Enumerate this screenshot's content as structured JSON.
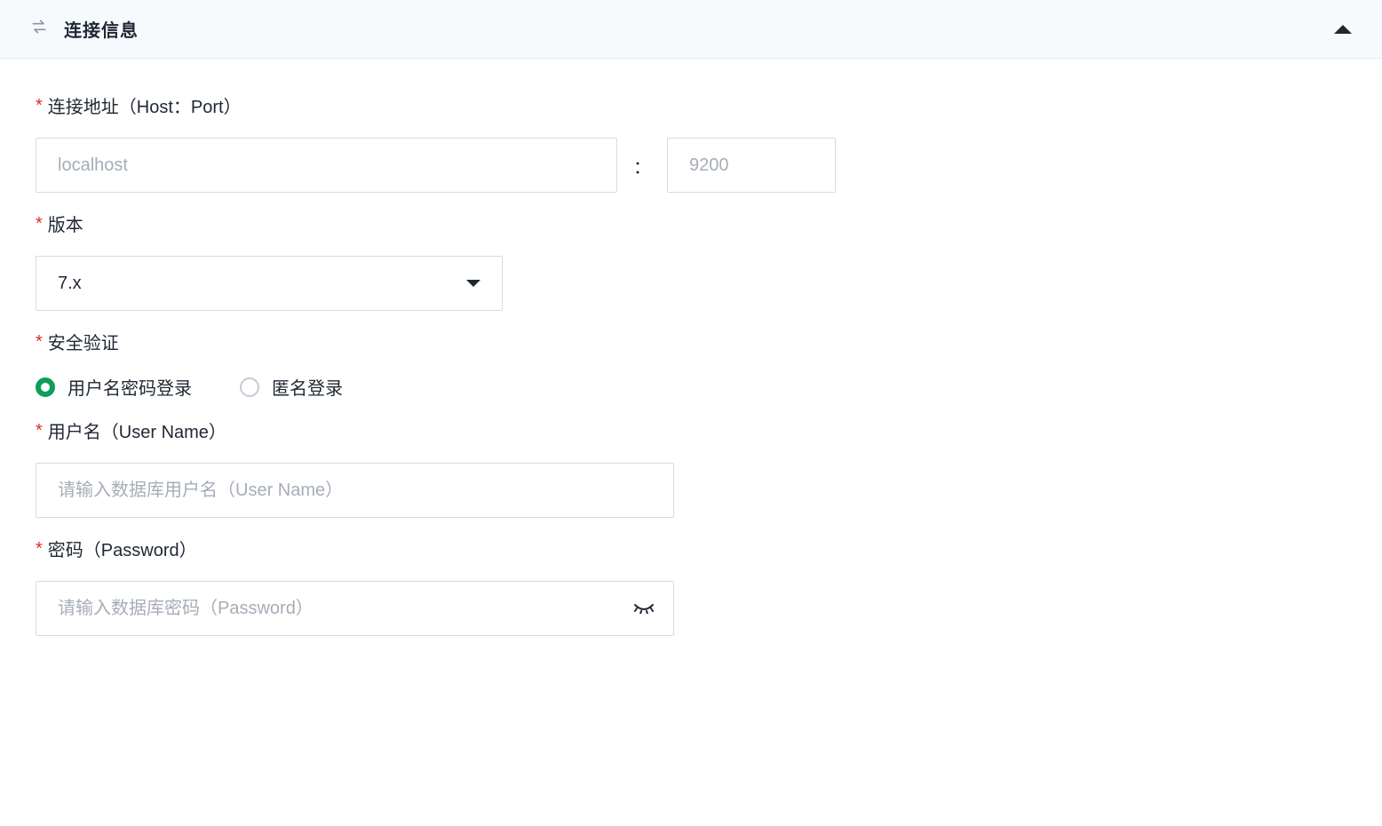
{
  "panel": {
    "title": "连接信息"
  },
  "fields": {
    "host": {
      "label": "连接地址（Host：Port）",
      "host_placeholder": "localhost",
      "separator": "：",
      "port_placeholder": "9200"
    },
    "version": {
      "label": "版本",
      "selected": "7.x"
    },
    "auth": {
      "label": "安全验证",
      "option_userpass": "用户名密码登录",
      "option_anonymous": "匿名登录"
    },
    "username": {
      "label": "用户名（User Name）",
      "placeholder": "请输入数据库用户名（User Name）"
    },
    "password": {
      "label": "密码（Password）",
      "placeholder": "请输入数据库密码（Password）"
    }
  },
  "required_marker": "*"
}
